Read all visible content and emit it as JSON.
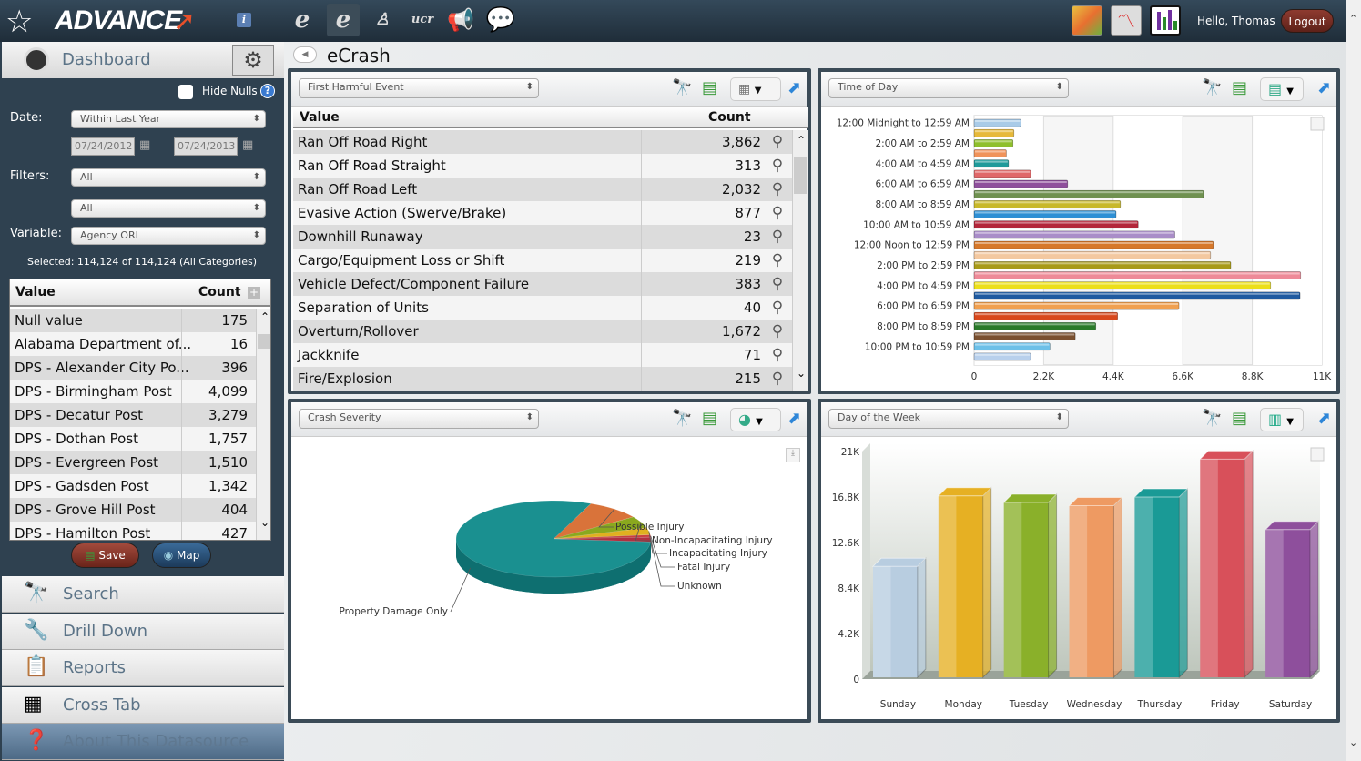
{
  "header": {
    "brand": "ADVANCE",
    "user_greeting": "Hello, Thomas",
    "logout_label": "Logout",
    "tool_icons": [
      "ecrash-badge-icon",
      "ecrash-burst-icon",
      "ecitation-person-icon",
      "ucr-document-icon",
      "megaphone-icon",
      "speech-bubble-icon"
    ],
    "app_icons": [
      "map-app-icon",
      "trend-chart-app-icon",
      "bar-chart-app-icon"
    ]
  },
  "sidebar": {
    "title": "Dashboard",
    "hide_nulls_label": "Hide Nulls",
    "hide_nulls_checked": false,
    "date_label": "Date:",
    "date_range": "Within Last Year",
    "date_from": "07/24/2012",
    "date_to": "07/24/2013",
    "filters_label": "Filters:",
    "filter1": "All",
    "filter2": "All",
    "variable_label": "Variable:",
    "variable": "Agency ORI",
    "selected_text": "Selected: 114,124 of 114,124 (All Categories)",
    "table": {
      "col_value": "Value",
      "col_count": "Count",
      "rows": [
        {
          "value": "Null value",
          "count": "175"
        },
        {
          "value": "Alabama Department of...",
          "count": "16"
        },
        {
          "value": "DPS - Alexander City Po...",
          "count": "396"
        },
        {
          "value": "DPS - Birmingham Post",
          "count": "4,099"
        },
        {
          "value": "DPS - Decatur Post",
          "count": "3,279"
        },
        {
          "value": "DPS - Dothan Post",
          "count": "1,757"
        },
        {
          "value": "DPS - Evergreen Post",
          "count": "1,510"
        },
        {
          "value": "DPS - Gadsden Post",
          "count": "1,342"
        },
        {
          "value": "DPS - Grove Hill Post",
          "count": "404"
        },
        {
          "value": "DPS - Hamilton Post",
          "count": "427"
        }
      ]
    },
    "save_label": "Save",
    "map_label": "Map",
    "nav": [
      {
        "label": "Search",
        "icon": "binoculars-icon"
      },
      {
        "label": "Drill Down",
        "icon": "drill-icon"
      },
      {
        "label": "Reports",
        "icon": "clipboard-icon"
      },
      {
        "label": "Cross Tab",
        "icon": "spreadsheet-icon"
      },
      {
        "label": "About This Datasource",
        "icon": "database-question-icon"
      }
    ]
  },
  "main": {
    "title": "eCrash",
    "panel1": {
      "select": "First Harmful Event",
      "col_value": "Value",
      "col_count": "Count",
      "rows": [
        {
          "value": "Ran Off Road Right",
          "count": "3,862"
        },
        {
          "value": "Ran Off Road Straight",
          "count": "313"
        },
        {
          "value": "Ran Off Road Left",
          "count": "2,032"
        },
        {
          "value": "Evasive Action (Swerve/Brake)",
          "count": "877"
        },
        {
          "value": "Downhill Runaway",
          "count": "23"
        },
        {
          "value": "Cargo/Equipment Loss or Shift",
          "count": "219"
        },
        {
          "value": "Vehicle Defect/Component Failure",
          "count": "383"
        },
        {
          "value": "Separation of Units",
          "count": "40"
        },
        {
          "value": "Overturn/Rollover",
          "count": "1,672"
        },
        {
          "value": "Jackknife",
          "count": "71"
        },
        {
          "value": "Fire/Explosion",
          "count": "215"
        }
      ]
    },
    "panel2": {
      "select": "Time of Day"
    },
    "panel3": {
      "select": "Crash Severity"
    },
    "panel4": {
      "select": "Day of the Week"
    }
  },
  "chart_data": [
    {
      "type": "bar",
      "orientation": "horizontal",
      "tick_labels": [
        "12:00 Midnight to 12:59 AM",
        "2:00 AM to 2:59 AM",
        "4:00 AM to 4:59 AM",
        "6:00 AM to 6:59 AM",
        "8:00 AM to 8:59 AM",
        "10:00 AM to 10:59 AM",
        "12:00 Noon to 12:59 PM",
        "2:00 PM to 2:59 PM",
        "4:00 PM to 4:59 PM",
        "6:00 PM to 6:59 PM",
        "8:00 PM to 8:59 PM",
        "10:00 PM to 10:59 PM"
      ],
      "values": [
        1480,
        1260,
        1230,
        1020,
        1090,
        1790,
        2960,
        7260,
        4630,
        4490,
        5190,
        6350,
        7570,
        7480,
        8120,
        10330,
        9380,
        10310,
        6480,
        4540,
        3850,
        3200,
        2400,
        1790
      ],
      "xlim": [
        0,
        11000
      ],
      "x_ticks": [
        "0",
        "2.2K",
        "4.4K",
        "6.6K",
        "8.8K",
        "11K"
      ],
      "grid": true,
      "colors": [
        "#a9cbe8",
        "#e6b93a",
        "#8fbf2c",
        "#f0935a",
        "#1f9a9a",
        "#e0686a",
        "#8f4f9c",
        "#6f9150",
        "#c8b82a",
        "#2e8fd4",
        "#b3263a",
        "#a98dc8",
        "#d6782a",
        "#f3c8a0",
        "#a89a18",
        "#ee8a98",
        "#ecdf1a",
        "#1f5aa0",
        "#f0a050",
        "#d8481c",
        "#2a7a2a",
        "#7a5030",
        "#6cc0e8",
        "#b8d0ec"
      ]
    },
    {
      "type": "pie",
      "style": "3d",
      "categories": [
        "Property Damage Only",
        "Possible Injury",
        "Non-Incapacitating Injury",
        "Incapacitating Injury",
        "Fatal Injury",
        "Unknown"
      ],
      "values": [
        80,
        9,
        5,
        3,
        1,
        2
      ],
      "colors": [
        "#1a9090",
        "#d9733a",
        "#8aa81e",
        "#e0b020",
        "#c84040",
        "#b03040"
      ]
    },
    {
      "type": "bar",
      "style": "3d",
      "categories": [
        "Sunday",
        "Monday",
        "Tuesday",
        "Wednesday",
        "Thursday",
        "Friday",
        "Saturday"
      ],
      "values": [
        10400,
        16900,
        16300,
        16000,
        16800,
        20300,
        13800
      ],
      "ylim": [
        0,
        21000
      ],
      "y_ticks": [
        "0",
        "4.2K",
        "8.4K",
        "12.6K",
        "16.8K",
        "21K"
      ],
      "grid": true,
      "colors": [
        "#b8cde0",
        "#e6b023",
        "#8ab02a",
        "#ee9a62",
        "#1a9a96",
        "#d8505a",
        "#8e4f9c"
      ]
    }
  ]
}
